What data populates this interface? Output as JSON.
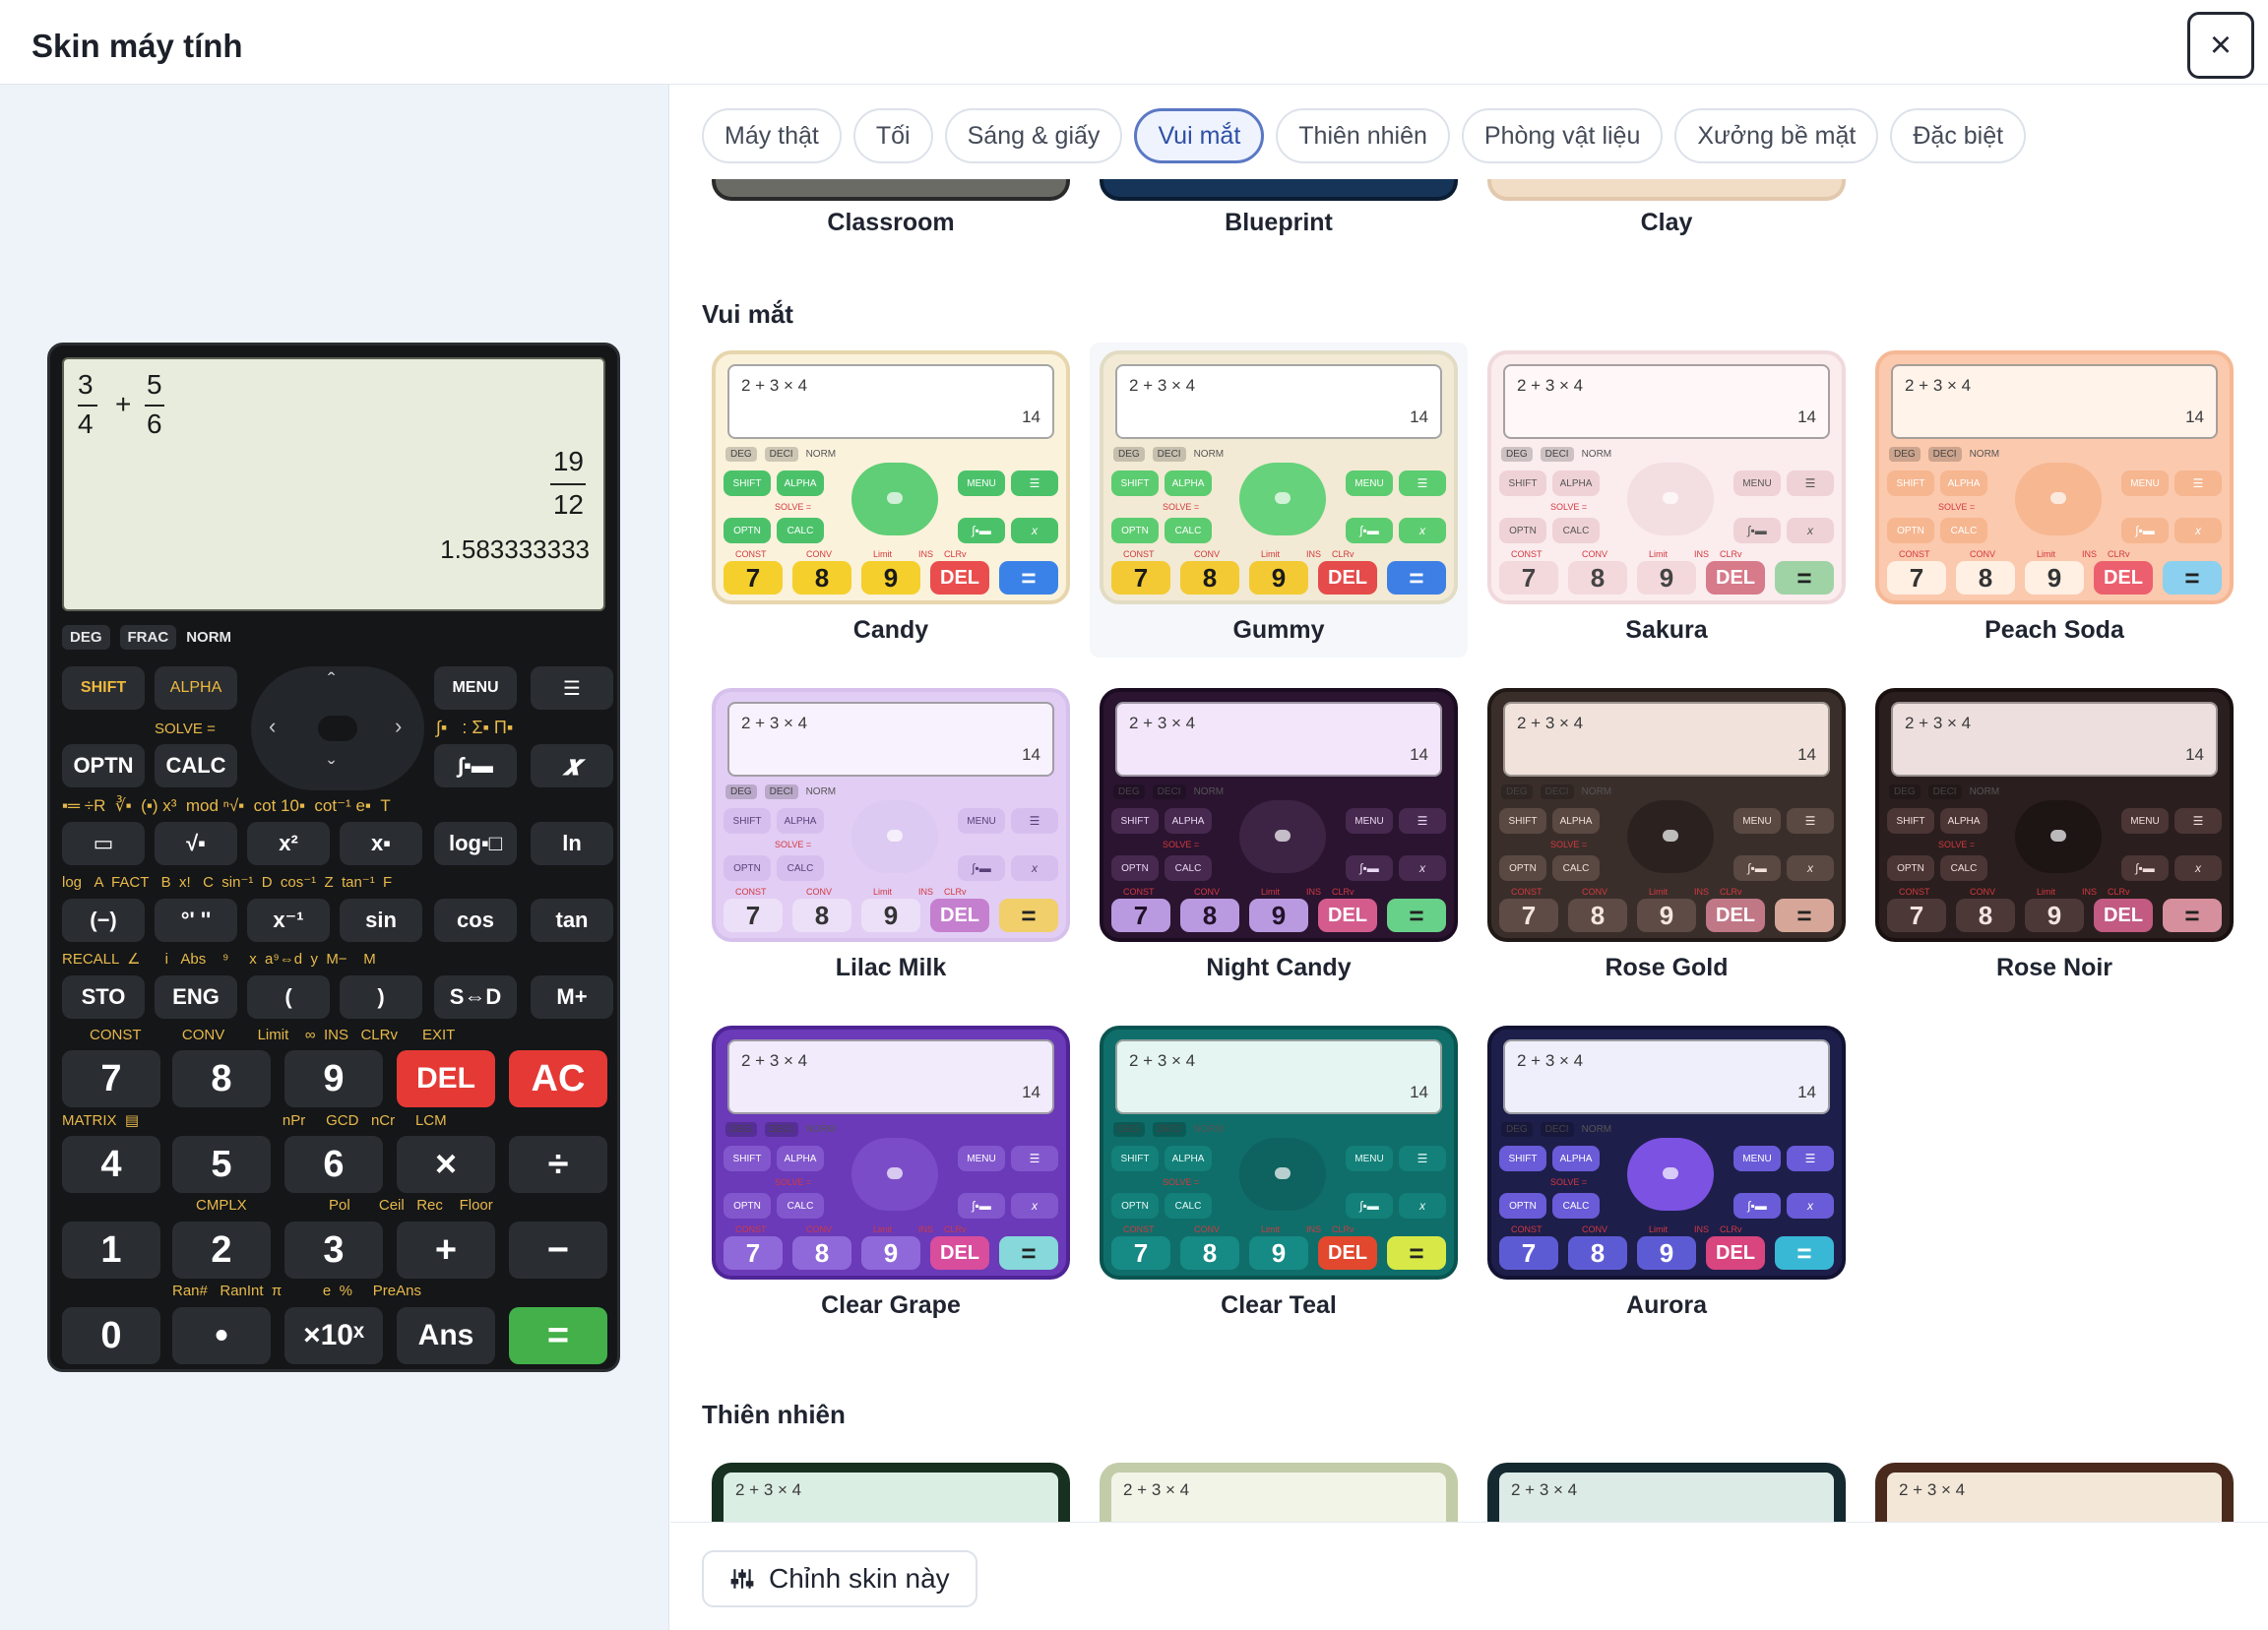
{
  "header": {
    "title": "Skin máy tính",
    "close_icon": "×"
  },
  "tabs": [
    "Máy thật",
    "Tối",
    "Sáng & giấy",
    "Vui mắt",
    "Thiên nhiên",
    "Phòng vật liệu",
    "Xưởng bề mặt",
    "Đặc biệt"
  ],
  "active_tab": "Vui mắt",
  "top_partial_cards": [
    "Classroom",
    "Blueprint",
    "Clay"
  ],
  "sections": [
    {
      "title": "Vui mắt"
    },
    {
      "title": "Thiên nhiên"
    }
  ],
  "thumb_common": {
    "expr": "2 + 3 × 4",
    "result": "14",
    "chip_deg": "DEG",
    "chip_deci": "DECI",
    "norm": "NORM",
    "shift": "SHIFT",
    "alpha": "ALPHA",
    "menu": "MENU",
    "optn": "OPTN",
    "calc": "CALC",
    "solve": "SOLVE =",
    "const": "CONST",
    "conv": "CONV",
    "limit": "Limit",
    "ins": "INS",
    "clrv": "CLRv",
    "k7": "7",
    "k8": "8",
    "k9": "9",
    "del": "DEL",
    "eq": "="
  },
  "skins": [
    {
      "name": "Candy",
      "bg": "#fbf2dc",
      "border": "#e7d6ad",
      "lcd": "#ffffff",
      "num": "#f5cf2c",
      "numText": "#1a1a1a",
      "del": "#ea4d4d",
      "eq": "#3b82e8",
      "fn": "#4bc26a",
      "fnText": "#fff",
      "dpad": "#5fce76"
    },
    {
      "name": "Gummy",
      "bg": "#f2ead4",
      "border": "#e2dcc5",
      "lcd": "#ffffff",
      "num": "#f3ca33",
      "numText": "#1a1a1a",
      "del": "#e54b4b",
      "eq": "#3d7fe4",
      "fn": "#5ccc70",
      "fnText": "#fff",
      "dpad": "#66d27b"
    },
    {
      "name": "Sakura",
      "bg": "#fbecee",
      "border": "#f0d9dc",
      "lcd": "#fff7f8",
      "num": "#f3d8dc",
      "numText": "#444",
      "del": "#d77a8a",
      "eq": "#9fd3a5",
      "fn": "#efd2d6",
      "fnText": "#555",
      "dpad": "#f3dfe2"
    },
    {
      "name": "Peach Soda",
      "bg": "#fbc9ad",
      "border": "#f5b895",
      "lcd": "#fff3ea",
      "num": "#fff0e3",
      "numText": "#333",
      "del": "#ec5f6e",
      "eq": "#8bd0ef",
      "fn": "#f6b690",
      "fnText": "#fff",
      "dpad": "#f6b791"
    },
    {
      "name": "Lilac Milk",
      "bg": "#e2cdf4",
      "border": "#d6c0ec",
      "lcd": "#f8f2fe",
      "num": "#ece0f8",
      "numText": "#333",
      "del": "#c57fcf",
      "eq": "#f1cf6b",
      "fn": "#d6bfee",
      "fnText": "#5a3f7a",
      "dpad": "#dccaf2"
    },
    {
      "name": "Night Candy",
      "bg": "#2a1430",
      "border": "#1c0c22",
      "lcd": "#f3e6fb",
      "num": "#b99ae0",
      "numText": "#22122a",
      "del": "#d45c8d",
      "eq": "#67d189",
      "fn": "#47294f",
      "fnText": "#ead8f2",
      "dpad": "#3d2445"
    },
    {
      "name": "Rose Gold",
      "bg": "#3a2e2b",
      "border": "#211915",
      "lcd": "#f1e3dc",
      "num": "#5e4b45",
      "numText": "#f4e6df",
      "del": "#c07887",
      "eq": "#d6a799",
      "fn": "#5a4843",
      "fnText": "#f0e1db",
      "dpad": "#2b2220"
    },
    {
      "name": "Rose Noir",
      "bg": "#2a1e1e",
      "border": "#1a1010",
      "lcd": "#eedfdf",
      "num": "#4d3838",
      "numText": "#f4e4e4",
      "del": "#c25a82",
      "eq": "#d68f9c",
      "fn": "#4b3535",
      "fnText": "#f0dede",
      "dpad": "#1d1414"
    },
    {
      "name": "Clear Grape",
      "bg": "#6a3ab8",
      "border": "#4e2496",
      "lcd": "#f1ebfc",
      "num": "#8f69da",
      "numText": "#fff",
      "del": "#d94d9d",
      "eq": "#86d8da",
      "fn": "#8257cd",
      "fnText": "#fff",
      "dpad": "#7b4cc8"
    },
    {
      "name": "Clear Teal",
      "bg": "#0f6e6a",
      "border": "#095451",
      "lcd": "#e5f6f2",
      "num": "#168a84",
      "numText": "#fff",
      "del": "#e2482d",
      "eq": "#d8e847",
      "fn": "#138079",
      "fnText": "#e8fbf8",
      "dpad": "#0e625f"
    },
    {
      "name": "Aurora",
      "bg": "#1e1e4a",
      "border": "#121233",
      "lcd": "#efeefb",
      "num": "#5d5bd4",
      "numText": "#fff",
      "del": "#d9457e",
      "eq": "#39b8d6",
      "fn": "#6a5bd8",
      "fnText": "#fff",
      "dpad": "#7c52e3"
    }
  ],
  "nature_partial": [
    {
      "bg": "#dbeee4",
      "border": "#17301f"
    },
    {
      "bg": "#f2f4e7",
      "border": "#c2cca8"
    },
    {
      "bg": "#dcebe6",
      "border": "#142a30"
    },
    {
      "bg": "#f3e7d8",
      "border": "#4a2a1c"
    }
  ],
  "bottom": {
    "edit_label": "Chỉnh skin này",
    "edit_icon": "sliders-icon"
  },
  "calc": {
    "frac1_num": "3",
    "frac1_den": "4",
    "plus": "+",
    "frac2_num": "5",
    "frac2_den": "6",
    "res_num": "19",
    "res_den": "12",
    "decimal": "1.583333333",
    "deg": "DEG",
    "frac": "FRAC",
    "norm": "NORM",
    "shift": "SHIFT",
    "alpha": "ALPHA",
    "menu": "MENU",
    "optn": "OPTN",
    "calc_key": "CALC",
    "solve": "SOLVE =",
    "row_funcs": [
      "▭",
      "√▪",
      "x²",
      "x▪",
      "log▪□",
      "ln"
    ],
    "row_trig": [
      "(−)",
      "°' ''",
      "x⁻¹",
      "sin",
      "cos",
      "tan"
    ],
    "row_mem": [
      "STO",
      "ENG",
      "(",
      ")",
      "S⇔D",
      "M+"
    ],
    "num_row1": [
      "7",
      "8",
      "9",
      "DEL",
      "AC"
    ],
    "num_row2": [
      "4",
      "5",
      "6",
      "×",
      "÷"
    ],
    "num_row3": [
      "1",
      "2",
      "3",
      "+",
      "−"
    ],
    "num_row4": [
      "0",
      "•",
      "×10ˣ",
      "Ans",
      "="
    ],
    "labels_recall": [
      "RECALL",
      "∠",
      "i",
      "Abs",
      "⁹",
      "x",
      "a⁹⇔d",
      "y",
      "M−",
      "M"
    ],
    "labels_const": [
      "CONST",
      "CONV",
      "Limit",
      "∞",
      "INS",
      "CLRv",
      "EXIT"
    ],
    "labels_matrix": [
      "MATRIX",
      "▤",
      "nPr",
      "GCD",
      "nCr",
      "LCM"
    ],
    "labels_cmplx": [
      "CMPLX",
      "Pol",
      "Ceil",
      "Rec",
      "Floor"
    ],
    "labels_ran": [
      "Ran#",
      "RanInt",
      "π",
      "e",
      "%",
      "PreAns"
    ],
    "labels_log": [
      "log",
      "A",
      "FACT",
      "B",
      "x!",
      "C",
      "sin⁻¹",
      "D",
      "cos⁻¹",
      "Z",
      "tan⁻¹",
      "F"
    ]
  }
}
